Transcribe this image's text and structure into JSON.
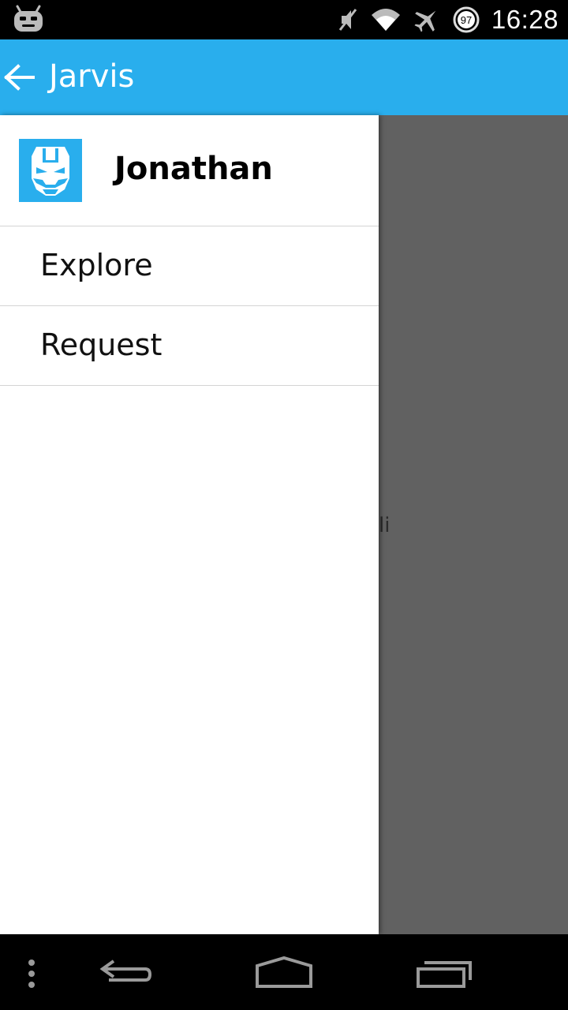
{
  "status_bar": {
    "time": "16:28",
    "battery_level": "97",
    "icons": [
      "cyanogen-mod-icon",
      "muted-icon",
      "wifi-icon",
      "airplane-icon",
      "battery-icon"
    ]
  },
  "app_bar": {
    "title": "Jarvis",
    "color": "#29aeed"
  },
  "drawer": {
    "user": {
      "name": "Jonathan",
      "avatar_icon": "iron-man-helmet-icon"
    },
    "items": [
      {
        "label": "Explore"
      },
      {
        "label": "Request"
      }
    ]
  },
  "content": {
    "partial_text": "li"
  },
  "nav_bar": {
    "icons": [
      "menu-dots-icon",
      "back-icon",
      "home-icon",
      "recents-icon"
    ]
  }
}
